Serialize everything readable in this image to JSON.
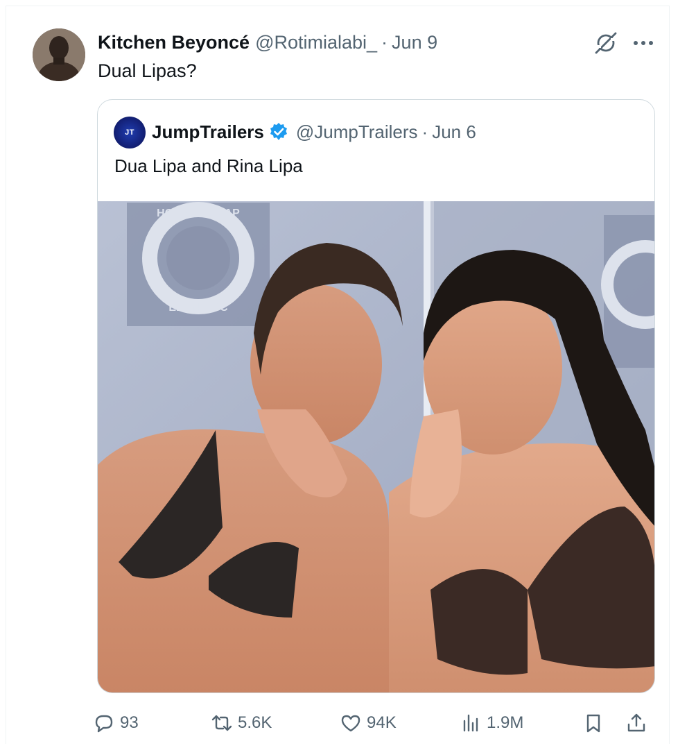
{
  "tweet": {
    "author_name": "Kitchen Beyoncé",
    "author_handle": "@Rotimialabi_",
    "separator": "·",
    "date": "Jun 9",
    "text": "Dual Lipas?"
  },
  "quoted_tweet": {
    "avatar_text": "JT",
    "author_name": "JumpTrailers",
    "verified": true,
    "author_handle": "@JumpTrailers",
    "separator": "·",
    "date": "Jun 6",
    "text": "Dua Lipa and Rina Lipa",
    "image_towel_text_top": "HOTEL DU CAP",
    "image_towel_text_bottom": "EDEN-ROC"
  },
  "actions": {
    "replies": "93",
    "reposts": "5.6K",
    "likes": "94K",
    "views": "1.9M"
  },
  "colors": {
    "secondary_text": "#536471",
    "primary_text": "#0f1419",
    "border": "#cfd9de",
    "verified_blue": "#1d9bf0"
  },
  "icons": [
    "grok-icon",
    "more-icon",
    "verified-badge-icon",
    "reply-icon",
    "repost-icon",
    "like-icon",
    "views-icon",
    "bookmark-icon",
    "share-icon"
  ]
}
